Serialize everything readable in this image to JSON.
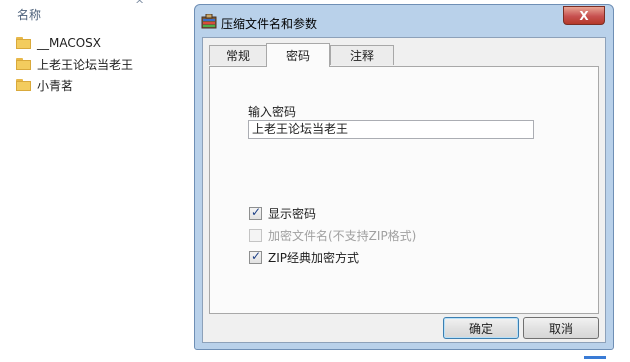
{
  "explorer": {
    "column_header": "名称",
    "sort_icon": "^",
    "items": [
      {
        "label": "__MACOSX",
        "icon": "folder-icon"
      },
      {
        "label": "上老王论坛当老王",
        "icon": "folder-icon"
      },
      {
        "label": "小青茗",
        "icon": "folder-icon"
      }
    ]
  },
  "dialog": {
    "title": "压缩文件名和参数",
    "close_glyph": "X",
    "tabs": [
      {
        "label": "常规",
        "active": false
      },
      {
        "label": "密码",
        "active": true
      },
      {
        "label": "注释",
        "active": false
      }
    ],
    "password_label": "输入密码",
    "password_value": "上老王论坛当老王",
    "checkboxes": [
      {
        "label": "显示密码",
        "checked": true,
        "enabled": true
      },
      {
        "label": "加密文件名(不支持ZIP格式)",
        "checked": false,
        "enabled": false
      },
      {
        "label": "ZIP经典加密方式",
        "checked": true,
        "enabled": true
      }
    ],
    "ok_label": "确定",
    "cancel_label": "取消"
  },
  "colors": {
    "dialog_frame": "#b9d1ea",
    "close_button": "#c75050",
    "folder": "#f3cc5e"
  }
}
